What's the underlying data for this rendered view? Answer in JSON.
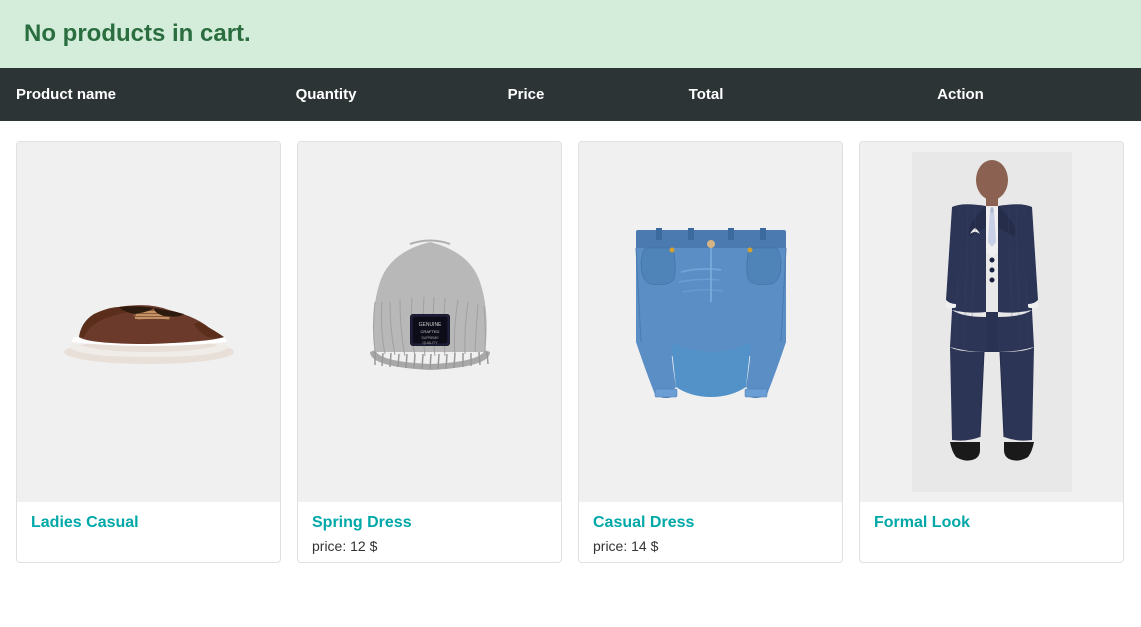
{
  "banner": {
    "text": "No products in cart."
  },
  "table_header": {
    "col1": "Product name",
    "col2": "Quantity",
    "col3": "Price",
    "col4": "Total",
    "col5": "Action"
  },
  "products": [
    {
      "id": "ladies-casual",
      "name": "Ladies Casual",
      "price": null,
      "price_label": null,
      "type": "shoe"
    },
    {
      "id": "spring-dress",
      "name": "Spring Dress",
      "price": "12",
      "price_label": "price: 12 $",
      "type": "hat"
    },
    {
      "id": "casual-dress",
      "name": "Casual Dress",
      "price": "14",
      "price_label": "price: 14 $",
      "type": "shorts"
    },
    {
      "id": "formal-look",
      "name": "Formal Look",
      "price": null,
      "price_label": null,
      "type": "suit"
    }
  ]
}
